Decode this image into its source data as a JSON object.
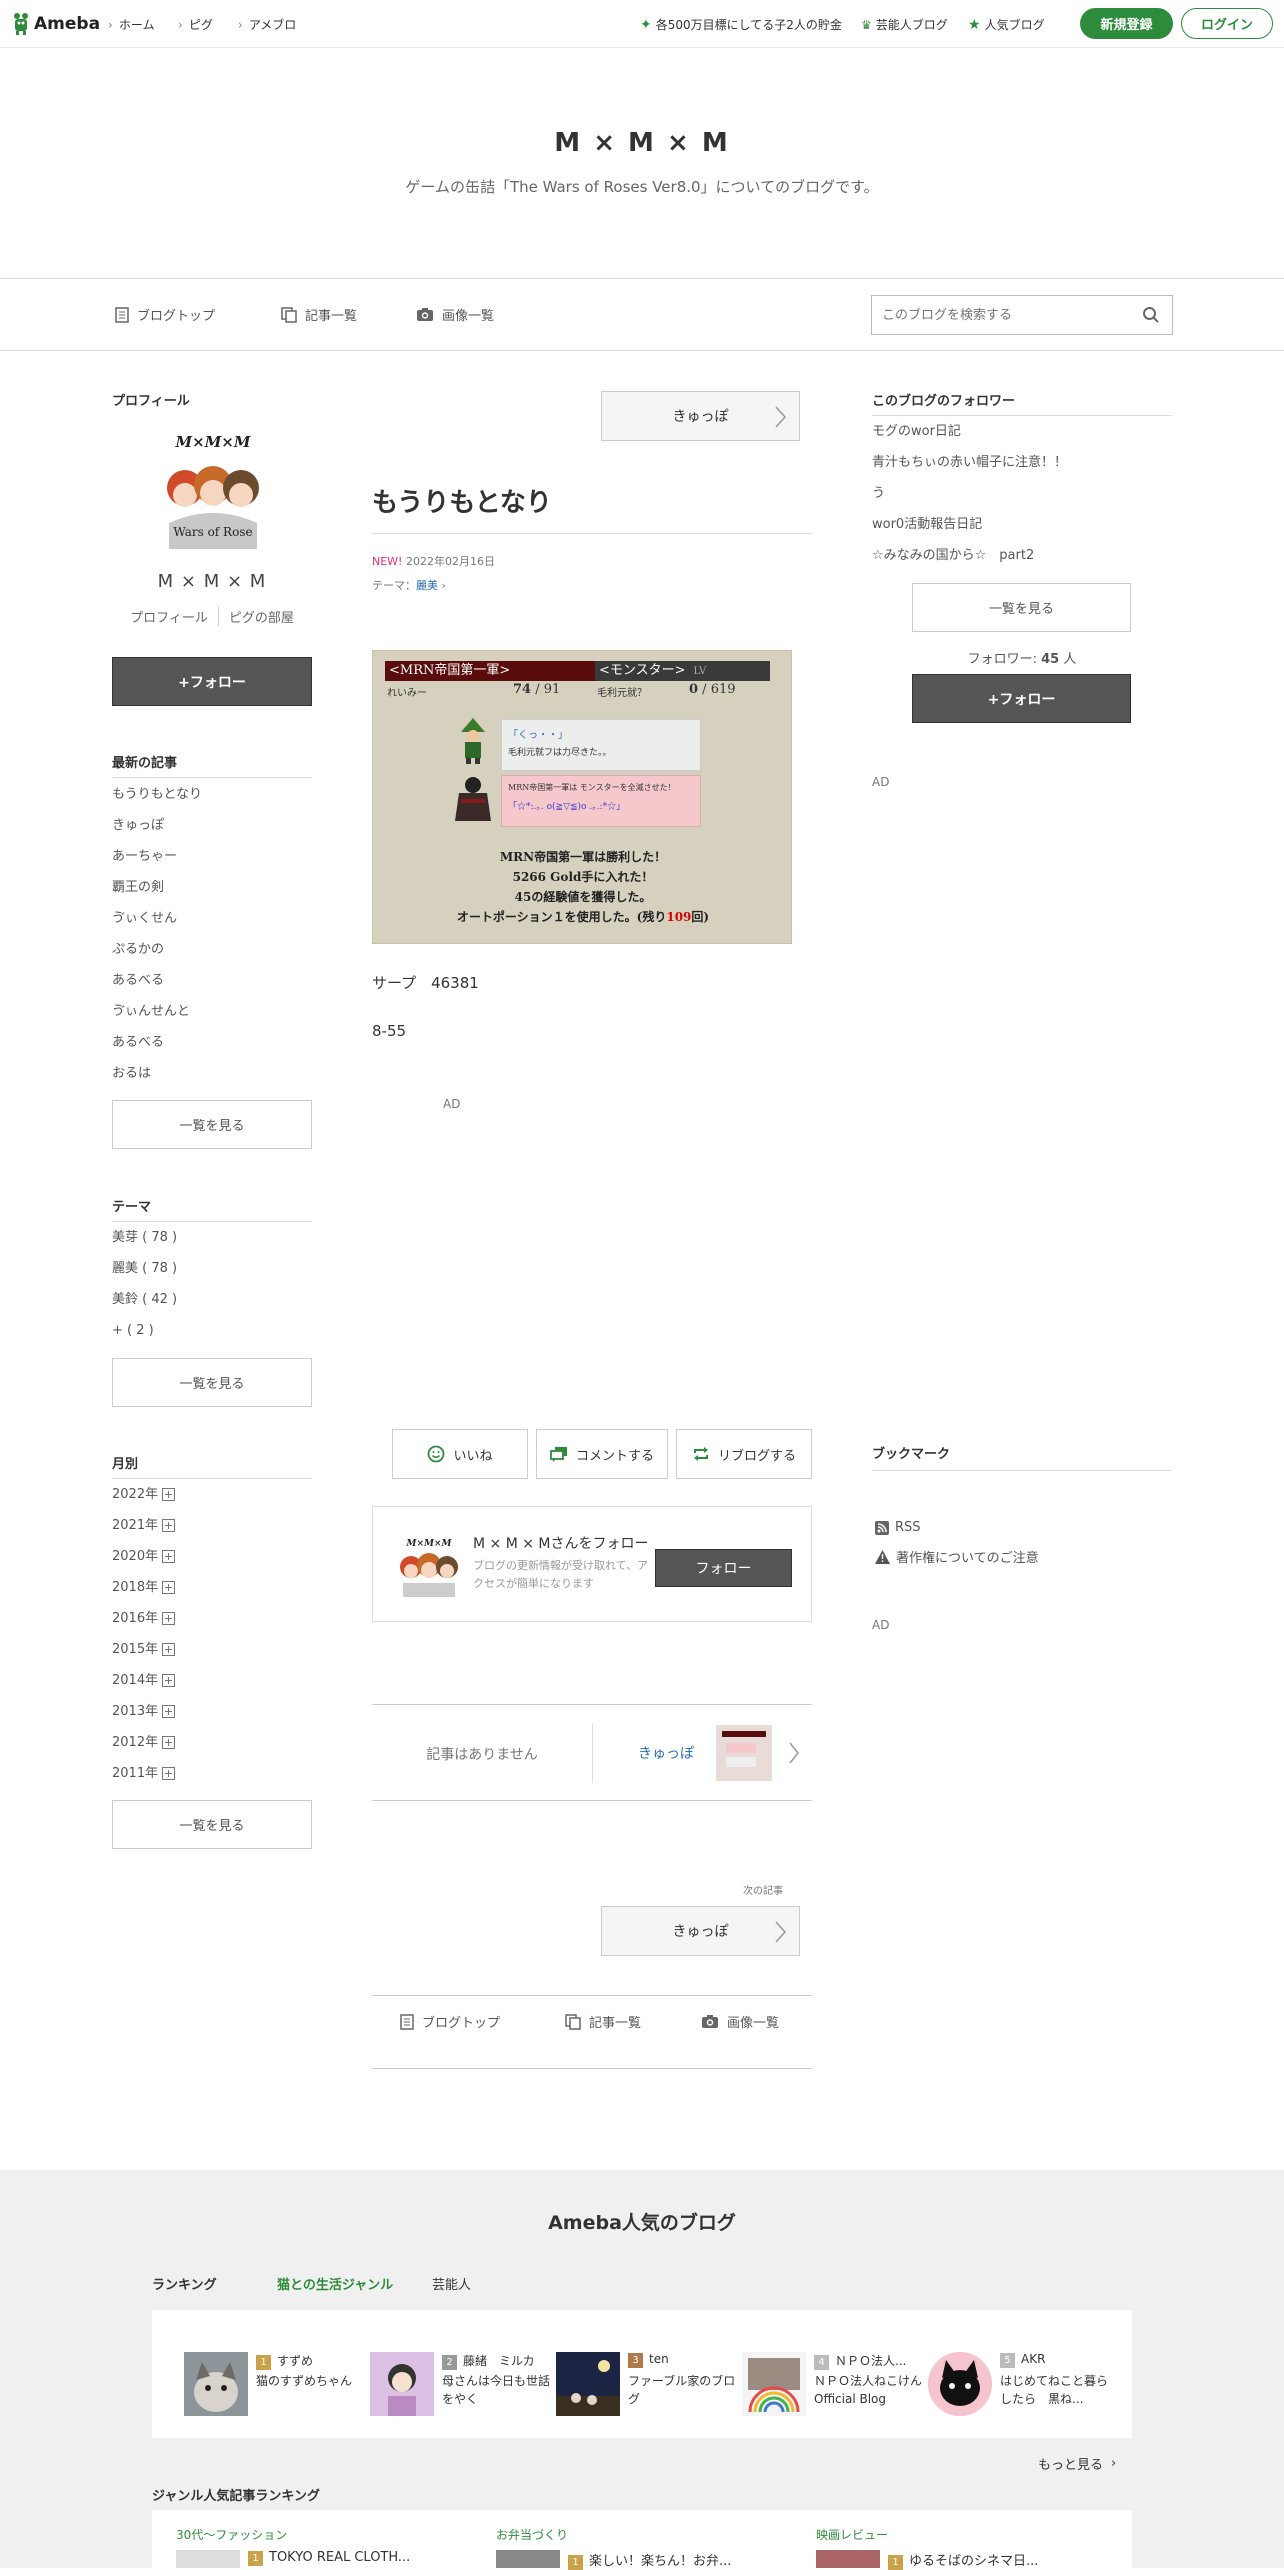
{
  "header": {
    "logo_text": "Ameba",
    "breadcrumbs": [
      "ホーム",
      "ピグ",
      "アメブロ"
    ],
    "links": [
      "各500万目標にしてる子2人の貯金",
      "芸能人ブログ",
      "人気ブログ"
    ],
    "signup_label": "新規登録",
    "login_label": "ログイン",
    "brand_color": "#2d8c3c"
  },
  "blog": {
    "title": "M × M × M",
    "description": "ゲームの缶詰「The Wars of Roses Ver8.0」についてのブログです。"
  },
  "nav": {
    "items": [
      "ブログトップ",
      "記事一覧",
      "画像一覧"
    ],
    "search_placeholder": "このブログを検索する"
  },
  "sidebar_left": {
    "profile_heading": "プロフィール",
    "profile_name": "M × M × M",
    "profile_link": "プロフィール",
    "pig_link": "ピグの部屋",
    "follow_label": "+フォロー",
    "recent_heading": "最新の記事",
    "recent": [
      "もうりもとなり",
      "きゅっぽ",
      "あーちゃー",
      "覇王の剣",
      "ゔぃくせん",
      "ぷるかの",
      "あるべる",
      "ゔぃんせんと",
      "あるべる",
      "おるは"
    ],
    "see_all": "一覧を見る",
    "theme_heading": "テーマ",
    "themes": [
      "美芽 ( 78 )",
      "麗美 ( 78 )",
      "美鈴 ( 42 )",
      "+ ( 2 )"
    ],
    "month_heading": "月別",
    "months": [
      "2022年",
      "2021年",
      "2020年",
      "2018年",
      "2016年",
      "2015年",
      "2014年",
      "2013年",
      "2012年",
      "2011年"
    ]
  },
  "article": {
    "prev_label": "きゅっぽ",
    "title": "もうりもとなり",
    "new_badge": "NEW!",
    "date": "2022年02月16日",
    "theme_prefix": "テーマ：",
    "theme": "麗美",
    "game": {
      "party_label": "<MRN帝国第一軍>",
      "monster_label": "<モンスター>",
      "monster_level": "LV",
      "player_name": "れいみー",
      "hp": "74",
      "hp_max": "91",
      "monster_name": "毛利元就？",
      "monster_hp": "0",
      "monster_hp_max": "619",
      "speech1": "「くっ・・」",
      "speech1b": "毛利元就フは力尽きた。。",
      "speech2": "MRN帝国第一軍は モンスターを全滅させた！",
      "speech2b": "「☆*:.｡. o(≧▽≦)o .｡.:*☆」",
      "result1": "MRN帝国第一軍は勝利した！",
      "result2": "5266 Gold手に入れた！",
      "result3": "45の経験値を獲得した。",
      "result4a": "オートポーション１を使用した。(残り",
      "result4b": "109",
      "result4c": "回)"
    },
    "body_line1": "サープ　46381",
    "body_line2": "8-55",
    "ad": "AD",
    "like_label": "いいね",
    "comment_label": "コメントする",
    "reblog_label": "リブログする",
    "follow_card_title": "M × M × Mさんをフォロー",
    "follow_card_desc": "ブログの更新情報が受け取れて、アクセスが簡単になります",
    "follow_card_button": "フォロー",
    "no_article": "記事はありません",
    "next_thumb_label": "きゅっぽ",
    "next_heading": "次の記事",
    "next_label": "きゅっぽ",
    "footer_nav": [
      "ブログトップ",
      "記事一覧",
      "画像一覧"
    ]
  },
  "sidebar_right": {
    "followers_heading": "このブログのフォロワー",
    "followers": [
      "モグのwor日記",
      "青汁もちぃの赤い帽子に注意！！",
      "う",
      "wor0活動報告日記",
      "☆みなみの国から☆　part2"
    ],
    "see_all": "一覧を見る",
    "follower_count_prefix": "フォロワー: ",
    "follower_count": "45",
    "follower_count_suffix": " 人",
    "follow_label": "+フォロー",
    "ad1": "AD",
    "bookmark_heading": "ブックマーク",
    "rss": "RSS",
    "copyright": "著作権についてのご注意",
    "ad2": "AD"
  },
  "footer": {
    "heading": "Ameba人気のブログ",
    "ranking_label": "ランキング",
    "tabs": [
      "猫との生活ジャンル",
      "芸能人"
    ],
    "cards": [
      {
        "rank": "1",
        "name": "すずめ",
        "desc": "猫のすずめちゃん"
      },
      {
        "rank": "2",
        "name": "藤緒　ミルカ",
        "desc": "母さんは今日も世話をやく"
      },
      {
        "rank": "3",
        "name": "ten",
        "desc": "ファーブル家のブログ"
      },
      {
        "rank": "4",
        "name": "ＮＰＯ法人...",
        "desc": "ＮＰＯ法人ねこけん Official Blog"
      },
      {
        "rank": "5",
        "name": "AKR",
        "desc": "はじめてねこと暮らしたら　黒ね..."
      }
    ],
    "more_label": "もっと見る",
    "genre_heading": "ジャンル人気記事ランキング",
    "genres": [
      "30代〜ファッション",
      "お弁当づくり",
      "映画レビュー"
    ],
    "genre_items": [
      "TOKYO REAL CLOTH...",
      "楽しい！楽ちん！お弁...",
      "ゆるそばのシネマ日..."
    ]
  }
}
